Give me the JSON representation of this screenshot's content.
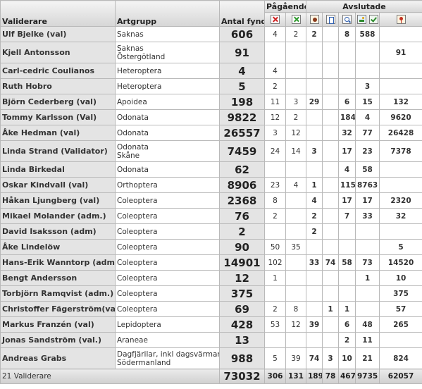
{
  "headers": {
    "validerare": "Validerare",
    "artgrupp": "Artgrupp",
    "antal": "Antal fynd",
    "pagaende": "Pågående",
    "avslutade": "Avslutade"
  },
  "icons": [
    "x-red-icon",
    "x-green-icon",
    "bug-icon",
    "document-icon",
    "magnifier-icon",
    "image-icon",
    "check-icon",
    "award-icon"
  ],
  "rows": [
    {
      "name": "Ulf Bjelke (val)",
      "art": "Saknas",
      "total": "606",
      "c": [
        "4",
        "2",
        "2",
        "",
        "8",
        "588",
        ""
      ]
    },
    {
      "name": "Kjell Antonsson",
      "art": "Saknas\nÖstergötland",
      "total": "91",
      "c": [
        "",
        "",
        "",
        "",
        "",
        "",
        "91"
      ]
    },
    {
      "name": "Carl-cedric Coulianos",
      "art": "Heteroptera",
      "total": "4",
      "c": [
        "4",
        "",
        "",
        "",
        "",
        "",
        ""
      ]
    },
    {
      "name": "Ruth Hobro",
      "art": "Heteroptera",
      "total": "5",
      "c": [
        "2",
        "",
        "",
        "",
        "",
        "3",
        ""
      ]
    },
    {
      "name": "Björn Cederberg (val)",
      "art": "Apoidea",
      "total": "198",
      "c": [
        "11",
        "3",
        "29",
        "",
        "6",
        "15",
        "132"
      ]
    },
    {
      "name": "Tommy Karlsson (Val)",
      "art": "Odonata",
      "total": "9822",
      "c": [
        "12",
        "2",
        "",
        "",
        "184",
        "4",
        "9620"
      ]
    },
    {
      "name": "Åke Hedman (val)",
      "art": "Odonata",
      "total": "26557",
      "c": [
        "3",
        "12",
        "",
        "",
        "32",
        "77",
        "26428"
      ]
    },
    {
      "name": "Linda Strand (Validator)",
      "art": "Odonata\nSkåne",
      "total": "7459",
      "c": [
        "24",
        "14",
        "3",
        "",
        "17",
        "23",
        "7378"
      ]
    },
    {
      "name": "Linda Birkedal",
      "art": "Odonata",
      "total": "62",
      "c": [
        "",
        "",
        "",
        "",
        "4",
        "58",
        ""
      ]
    },
    {
      "name": "Oskar Kindvall (val)",
      "art": "Orthoptera",
      "total": "8906",
      "c": [
        "23",
        "4",
        "1",
        "",
        "115",
        "8763",
        ""
      ]
    },
    {
      "name": "Håkan Ljungberg (val)",
      "art": "Coleoptera",
      "total": "2368",
      "c": [
        "8",
        "",
        "4",
        "",
        "17",
        "17",
        "2320"
      ]
    },
    {
      "name": "Mikael Molander (adm.)",
      "art": "Coleoptera",
      "total": "76",
      "c": [
        "2",
        "",
        "2",
        "",
        "7",
        "33",
        "32"
      ]
    },
    {
      "name": "David Isaksson (adm)",
      "art": "Coleoptera",
      "total": "2",
      "c": [
        "",
        "",
        "2",
        "",
        "",
        "",
        ""
      ]
    },
    {
      "name": "Åke Lindelöw",
      "art": "Coleoptera",
      "total": "90",
      "c": [
        "50",
        "35",
        "",
        "",
        "",
        "",
        "5"
      ]
    },
    {
      "name": "Hans-Erik Wanntorp (adm)",
      "art": "Coleoptera",
      "total": "14901",
      "c": [
        "102",
        "",
        "33",
        "74",
        "58",
        "73",
        "14520"
      ]
    },
    {
      "name": "Bengt Andersson",
      "art": "Coleoptera",
      "total": "12",
      "c": [
        "1",
        "",
        "",
        "",
        "",
        "1",
        "10"
      ]
    },
    {
      "name": "Torbjörn Ramqvist (adm.)",
      "art": "Coleoptera",
      "total": "375",
      "c": [
        "",
        "",
        "",
        "",
        "",
        "",
        "375"
      ]
    },
    {
      "name": "Christoffer Fägerström(val)",
      "art": "Coleoptera",
      "total": "69",
      "c": [
        "2",
        "8",
        "",
        "1",
        "1",
        "",
        "57"
      ]
    },
    {
      "name": "Markus Franzén (val)",
      "art": "Lepidoptera",
      "total": "428",
      "c": [
        "53",
        "12",
        "39",
        "",
        "6",
        "48",
        "265"
      ]
    },
    {
      "name": "Jonas Sandström (val.)",
      "art": "Araneae",
      "total": "13",
      "c": [
        "",
        "",
        "",
        "",
        "2",
        "11",
        ""
      ]
    },
    {
      "name": "Andreas Grabs",
      "art": "Dagfjärilar, inkl dagsvärmare\nSödermanland",
      "total": "988",
      "c": [
        "5",
        "39",
        "74",
        "3",
        "10",
        "21",
        "824"
      ]
    }
  ],
  "footer": {
    "label": "21 Validerare",
    "total": "73032",
    "c": [
      "306",
      "131",
      "189",
      "78",
      "467",
      "9735",
      "62057"
    ]
  }
}
